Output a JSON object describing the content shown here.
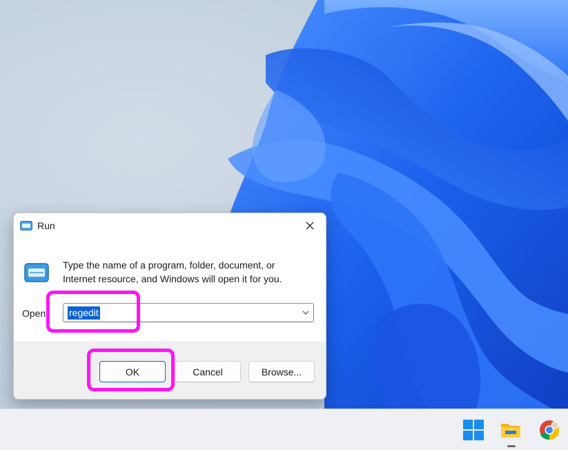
{
  "run_dialog": {
    "title": "Run",
    "description_line1": "Type the name of a program, folder, document, or",
    "description_line2": "Internet resource, and Windows will open it for you.",
    "open_label": "Open:",
    "open_value": "regedit",
    "buttons": {
      "ok": "OK",
      "cancel": "Cancel",
      "browse": "Browse..."
    }
  },
  "icons": {
    "title": "run-icon",
    "close": "close-icon",
    "dropdown": "chevron-down-icon",
    "start": "windows-logo-icon",
    "explorer": "folder-icon",
    "chrome": "chrome-icon"
  },
  "colors": {
    "highlight": "#ff13f5",
    "accent": "#0a62d4",
    "wallpaper_blue": "#1f6cf0"
  }
}
